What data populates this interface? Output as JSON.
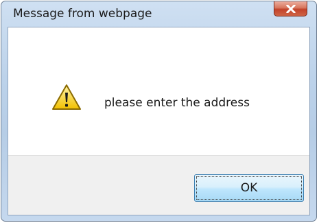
{
  "dialog": {
    "title": "Message from webpage",
    "message": "please enter the address",
    "icon": "warning-icon",
    "ok_label": "OK",
    "close_icon": "close-icon"
  },
  "colors": {
    "close_button": "#c2432a",
    "frame": "#b6cde6",
    "ok_button": "#bee6fd"
  }
}
